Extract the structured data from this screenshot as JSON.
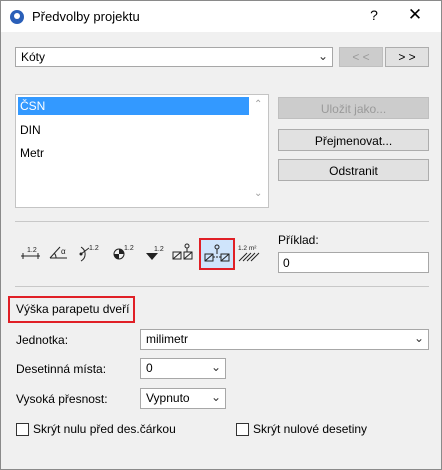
{
  "window": {
    "title": "Předvolby projektu",
    "help": "?",
    "close": "✕"
  },
  "category": {
    "value": "Kóty",
    "prev_label": "< <",
    "next_label": "> >"
  },
  "styles": {
    "items": [
      {
        "label": "ČSN",
        "selected": true
      },
      {
        "label": "DIN",
        "selected": false
      },
      {
        "label": "Metr",
        "selected": false
      }
    ]
  },
  "actions": {
    "save_as": "Uložit jako...",
    "rename": "Přejmenovat...",
    "delete": "Odstranit"
  },
  "dimension_types": [
    {
      "name": "linear-dimension-icon",
      "text": "1.2"
    },
    {
      "name": "angle-dimension-icon",
      "text": "α"
    },
    {
      "name": "radius-dimension-icon",
      "text": "1.2"
    },
    {
      "name": "level-dimension-icon",
      "text": "1.2"
    },
    {
      "name": "elevation-dimension-icon",
      "text": "1.2"
    },
    {
      "name": "window-sill-height-icon",
      "text": ""
    },
    {
      "name": "door-sill-height-icon",
      "text": ""
    },
    {
      "name": "area-dimension-icon",
      "text": "1.2 m²"
    }
  ],
  "example": {
    "label": "Příklad:",
    "value": "0"
  },
  "section_title": "Výška parapetu dveří",
  "unit": {
    "label": "Jednotka:",
    "value": "milimetr"
  },
  "decimals": {
    "label": "Desetinná místa:",
    "value": "0"
  },
  "precision": {
    "label": "Vysoká přesnost:",
    "value": "Vypnuto"
  },
  "options": {
    "hide_leading_zero": "Skrýt nulu před des.čárkou",
    "hide_trailing_zeros": "Skrýt nulové desetiny"
  },
  "colors": {
    "selection": "#3399ff",
    "highlight": "#e01f26"
  }
}
